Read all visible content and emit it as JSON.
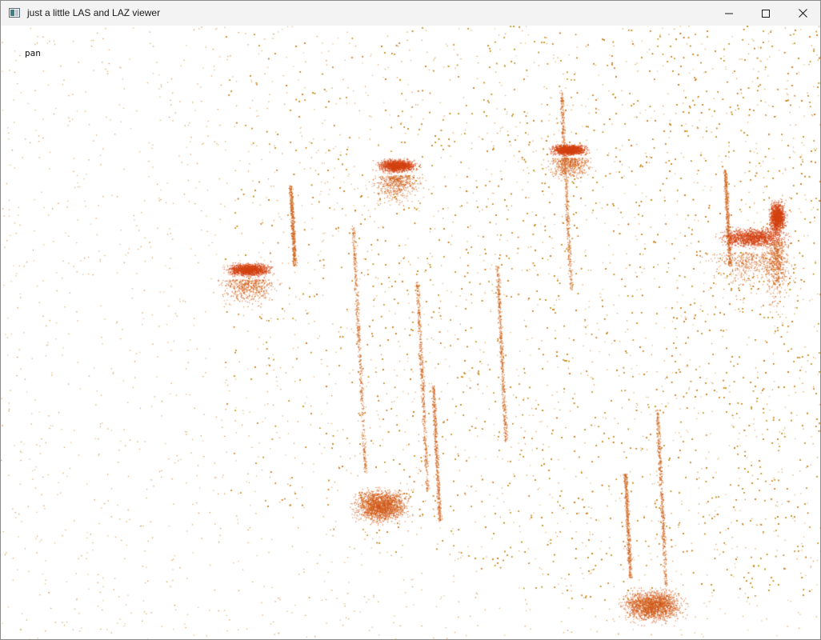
{
  "window": {
    "title": "just a little LAS and LAZ viewer",
    "icon": "app-window-icon",
    "controls": {
      "minimize": "minimize-icon",
      "maximize": "maximize-icon",
      "close": "close-icon"
    }
  },
  "viewer": {
    "mode_label": "pan",
    "background": "#ffffff",
    "colors": {
      "low": "#c9a227",
      "high": "#d43a0f"
    }
  }
}
